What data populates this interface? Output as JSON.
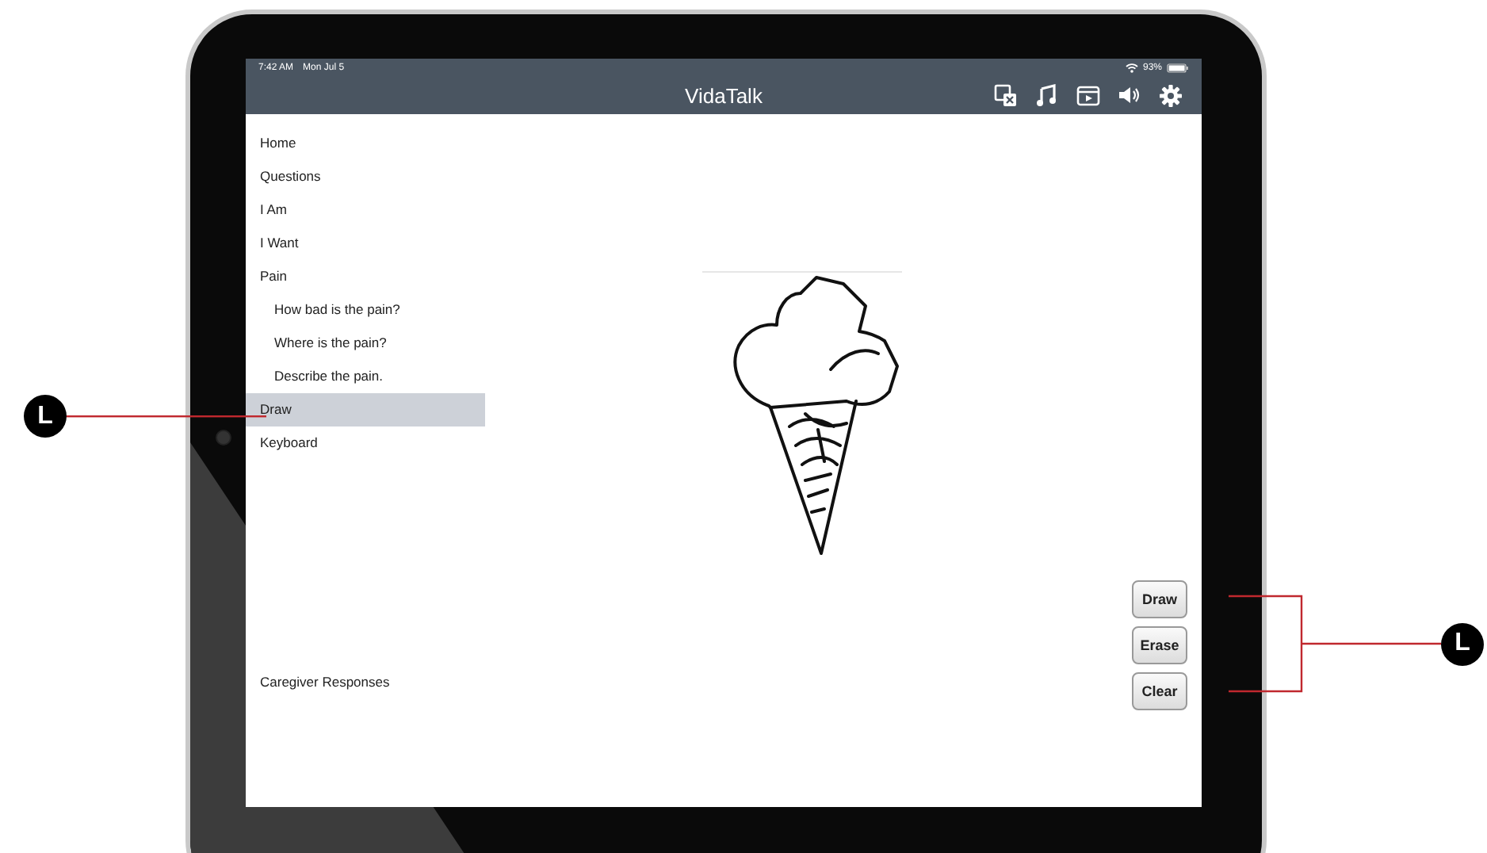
{
  "status_bar": {
    "time": "7:42 AM",
    "date": "Mon Jul 5",
    "battery": "93%"
  },
  "nav_bar": {
    "title": "VidaTalk"
  },
  "sidebar": {
    "items": [
      {
        "label": "Home",
        "selected": false
      },
      {
        "label": "Questions",
        "selected": false
      },
      {
        "label": "I Am",
        "selected": false
      },
      {
        "label": "I Want",
        "selected": false
      },
      {
        "label": "Pain",
        "selected": false,
        "children": [
          {
            "label": "How bad is the pain?",
            "selected": false
          },
          {
            "label": "Where is the pain?",
            "selected": false
          },
          {
            "label": "Describe the pain.",
            "selected": false
          }
        ]
      },
      {
        "label": "Draw",
        "selected": true
      },
      {
        "label": "Keyboard",
        "selected": false
      }
    ],
    "footer": "Caregiver Responses"
  },
  "drawing_tools": {
    "buttons": [
      {
        "label": "Draw"
      },
      {
        "label": "Erase"
      },
      {
        "label": "Clear"
      }
    ]
  },
  "callouts": [
    {
      "label": "L"
    },
    {
      "label": "L"
    }
  ]
}
